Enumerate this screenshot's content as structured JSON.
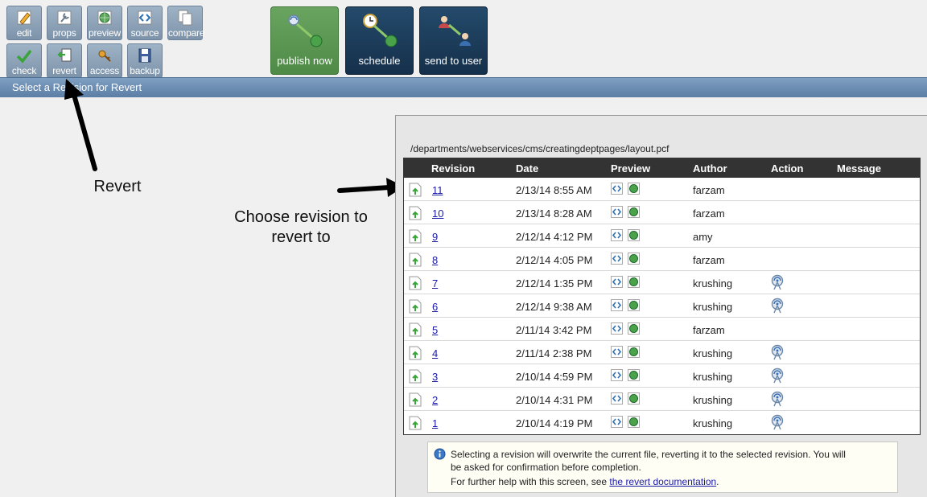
{
  "toolbar": {
    "small_buttons": [
      {
        "label": "edit",
        "icon": "pencil-icon"
      },
      {
        "label": "props",
        "icon": "wrench-icon"
      },
      {
        "label": "preview",
        "icon": "globe-icon"
      },
      {
        "label": "source",
        "icon": "code-icon"
      },
      {
        "label": "compare",
        "icon": "documents-icon"
      },
      {
        "label": "check",
        "icon": "checkmark-icon"
      },
      {
        "label": "revert",
        "icon": "revert-icon"
      },
      {
        "label": "access",
        "icon": "key-icon"
      },
      {
        "label": "backup",
        "icon": "floppy-icon"
      }
    ],
    "big_buttons": [
      {
        "label": "publish now",
        "icon": "publish-icon"
      },
      {
        "label": "schedule",
        "icon": "clock-icon"
      },
      {
        "label": "send to user",
        "icon": "users-icon"
      }
    ]
  },
  "title_bar": {
    "text": "Select a Revision for Revert"
  },
  "annotations": {
    "revert": "Revert",
    "choose_line1": "Choose revision to",
    "choose_line2": "revert to"
  },
  "file_path": "/departments/webservices/cms/creatingdeptpages/layout.pcf",
  "table": {
    "headers": [
      "Revision",
      "Date",
      "Preview",
      "Author",
      "Action",
      "Message"
    ],
    "rows": [
      {
        "revision": "11",
        "date": "2/13/14 8:55 AM",
        "author": "farzam",
        "action": false
      },
      {
        "revision": "10",
        "date": "2/13/14 8:28 AM",
        "author": "farzam",
        "action": false
      },
      {
        "revision": "9",
        "date": "2/12/14 4:12 PM",
        "author": "amy",
        "action": false
      },
      {
        "revision": "8",
        "date": "2/12/14 4:05 PM",
        "author": "farzam",
        "action": false
      },
      {
        "revision": "7",
        "date": "2/12/14 1:35 PM",
        "author": "krushing",
        "action": true
      },
      {
        "revision": "6",
        "date": "2/12/14 9:38 AM",
        "author": "krushing",
        "action": true
      },
      {
        "revision": "5",
        "date": "2/11/14 3:42 PM",
        "author": "farzam",
        "action": false
      },
      {
        "revision": "4",
        "date": "2/11/14 2:38 PM",
        "author": "krushing",
        "action": true
      },
      {
        "revision": "3",
        "date": "2/10/14 4:59 PM",
        "author": "krushing",
        "action": true
      },
      {
        "revision": "2",
        "date": "2/10/14 4:31 PM",
        "author": "krushing",
        "action": true
      },
      {
        "revision": "1",
        "date": "2/10/14 4:19 PM",
        "author": "krushing",
        "action": true
      }
    ]
  },
  "info": {
    "line1": "Selecting a revision will overwrite the current file, reverting it to the selected revision. You will",
    "line2": "be asked for confirmation before completion.",
    "line3_prefix": "For further help with this screen, see ",
    "link_text": "the revert documentation",
    "line3_suffix": "."
  },
  "colors": {
    "title_bar": "#6a8bb3",
    "publish_button": "#5a9652",
    "navy_button": "#1b3a59",
    "link": "#1a1aa6"
  }
}
